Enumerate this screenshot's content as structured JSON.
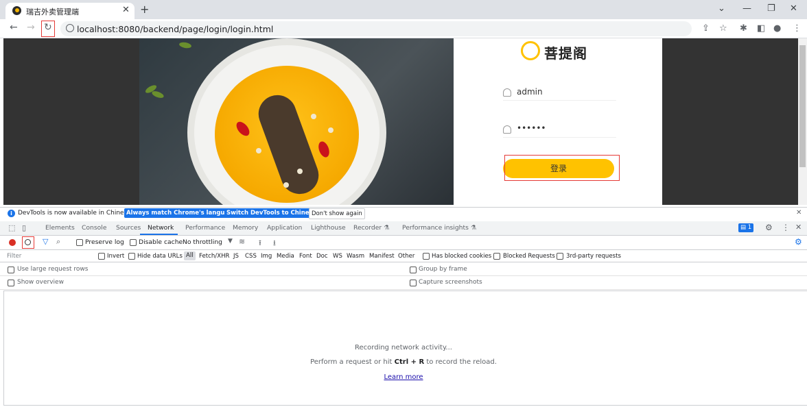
{
  "browser": {
    "tab_title": "瑞吉外卖管理端",
    "url": "localhost:8080/backend/page/login/login.html"
  },
  "login": {
    "brand": "菩提阁",
    "username": "admin",
    "password": "••••••",
    "button": "登录"
  },
  "devtools": {
    "infobar": {
      "message": "DevTools is now available in Chinese!",
      "btn_match": "Always match Chrome's language",
      "btn_switch": "Switch DevTools to Chinese",
      "btn_dismiss": "Don't show again"
    },
    "tabs": [
      "Elements",
      "Console",
      "Sources",
      "Network",
      "Performance",
      "Memory",
      "Application",
      "Lighthouse",
      "Recorder ⚗",
      "Performance insights ⚗"
    ],
    "active_tab": "Network",
    "issues_count": "1",
    "toolbar": {
      "preserve_log": "Preserve log",
      "disable_cache": "Disable cache",
      "throttling": "No throttling"
    },
    "filter": {
      "placeholder": "Filter",
      "invert": "Invert",
      "hide_data_urls": "Hide data URLs",
      "types": [
        "All",
        "Fetch/XHR",
        "JS",
        "CSS",
        "Img",
        "Media",
        "Font",
        "Doc",
        "WS",
        "Wasm",
        "Manifest",
        "Other"
      ],
      "has_blocked_cookies": "Has blocked cookies",
      "blocked_requests": "Blocked Requests",
      "third_party": "3rd-party requests"
    },
    "settings": {
      "large_rows": "Use large request rows",
      "group_by_frame": "Group by frame",
      "show_overview": "Show overview",
      "capture_screenshots": "Capture screenshots"
    },
    "empty": {
      "recording": "Recording network activity...",
      "hint_prefix": "Perform a request or hit ",
      "hint_keys": "Ctrl + R",
      "hint_suffix": " to record the reload.",
      "learn_more": "Learn more"
    }
  }
}
